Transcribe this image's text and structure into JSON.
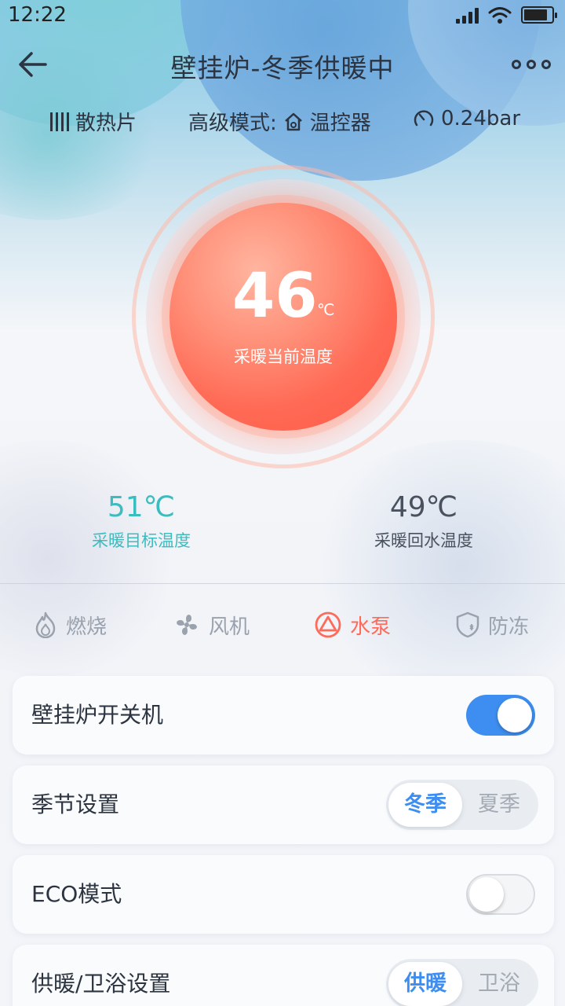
{
  "status_bar": {
    "time": "12:22",
    "battery_level": 0.85
  },
  "header": {
    "title": "壁挂炉-冬季供暖中"
  },
  "info": {
    "heating_type": "散热片",
    "mode_prefix": "高级模式:",
    "mode_value": "温控器",
    "pressure": "0.24bar"
  },
  "dial": {
    "current_temp": "46",
    "unit": "℃",
    "label": "采暖当前温度"
  },
  "stats": {
    "target_value": "51℃",
    "target_label": "采暖目标温度",
    "return_value": "49℃",
    "return_label": "采暖回水温度"
  },
  "tabs": [
    {
      "label": "燃烧",
      "icon": "flame-icon"
    },
    {
      "label": "风机",
      "icon": "fan-icon"
    },
    {
      "label": "水泵",
      "icon": "pump-icon",
      "active": true
    },
    {
      "label": "防冻",
      "icon": "shield-icon"
    }
  ],
  "colors": {
    "accent": "#3d8ef0",
    "active_tab": "#ff6b5a",
    "target_temp": "#3bbdc0"
  },
  "settings": {
    "power": {
      "label": "壁挂炉开关机",
      "on": true
    },
    "season": {
      "label": "季节设置",
      "options": [
        "冬季",
        "夏季"
      ],
      "selected": "冬季"
    },
    "eco": {
      "label": "ECO模式",
      "on": false
    },
    "mode": {
      "label": "供暖/卫浴设置",
      "options": [
        "供暖",
        "卫浴"
      ],
      "selected": "供暖"
    }
  }
}
